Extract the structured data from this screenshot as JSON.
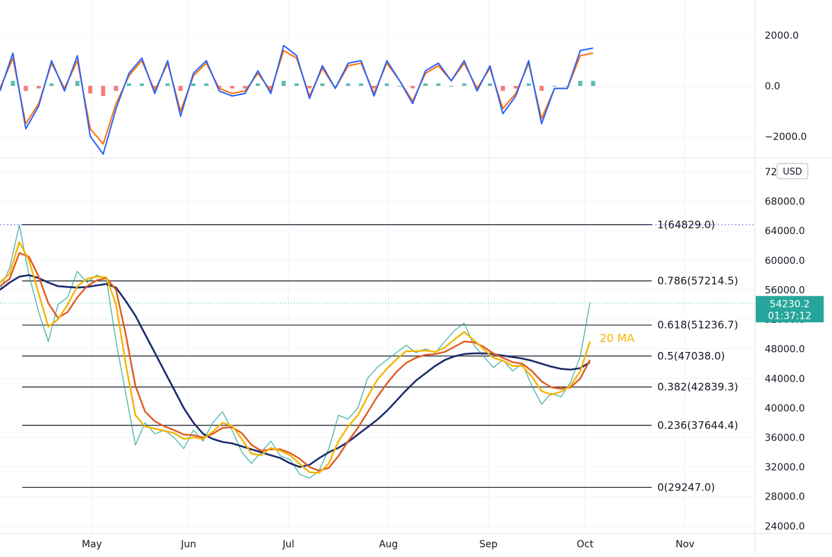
{
  "chart_data": [
    {
      "type": "line",
      "panel": "oscillator",
      "y_ticks": [
        "2000.0",
        "0.0",
        "−2000.0"
      ],
      "y_tick_values": [
        2000,
        0,
        -2000
      ],
      "ylim": [
        -2800,
        2800
      ],
      "grid": true,
      "colors": {
        "fast": "#2962ff",
        "signal": "#ff6d00",
        "hist_up": "#26a69a",
        "hist_down": "#ef5350"
      },
      "x": [
        0,
        4,
        8,
        12,
        16,
        20,
        24,
        28,
        32,
        36,
        40,
        44,
        48,
        52,
        56,
        60,
        64,
        68,
        72,
        76,
        80,
        84,
        88,
        92,
        96,
        100,
        104,
        108,
        112,
        116,
        120,
        124,
        128,
        132,
        136,
        140,
        144,
        148,
        152,
        156,
        160,
        164,
        168,
        172,
        176,
        180,
        184
      ],
      "series": [
        {
          "role": "fast",
          "values": [
            -200,
            1300,
            -1700,
            -800,
            1000,
            -200,
            1200,
            -2000,
            -2700,
            -900,
            500,
            1100,
            -300,
            1000,
            -1200,
            500,
            1000,
            -200,
            -400,
            -300,
            600,
            -300,
            1600,
            1200,
            -500,
            800,
            -100,
            900,
            1000,
            -400,
            1000,
            200,
            -700,
            600,
            900,
            200,
            1000,
            -200,
            800,
            -1100,
            -400,
            1000,
            -1500,
            -100,
            -100,
            1400,
            1500
          ]
        },
        {
          "role": "signal",
          "values": [
            -100,
            1100,
            -1500,
            -700,
            900,
            -100,
            1000,
            -1700,
            -2300,
            -700,
            400,
            1000,
            -200,
            900,
            -1000,
            400,
            900,
            -100,
            -300,
            -200,
            500,
            -200,
            1400,
            1100,
            -400,
            700,
            -100,
            800,
            900,
            -300,
            900,
            200,
            -600,
            500,
            800,
            200,
            900,
            -100,
            700,
            -900,
            -300,
            900,
            -1300,
            -100,
            -100,
            1200,
            1300
          ]
        },
        {
          "role": "histogram",
          "values": [
            -100,
            200,
            -200,
            -100,
            100,
            -100,
            200,
            -300,
            -400,
            -200,
            100,
            100,
            -100,
            100,
            -200,
            100,
            100,
            -100,
            -100,
            -100,
            100,
            -100,
            200,
            100,
            -100,
            100,
            0,
            100,
            100,
            -100,
            100,
            0,
            -100,
            100,
            100,
            0,
            100,
            -100,
            100,
            -200,
            -100,
            100,
            -200,
            0,
            0,
            200,
            200
          ]
        }
      ]
    },
    {
      "type": "line",
      "panel": "price",
      "currency": "USD",
      "y_ticks": [
        "72000.0",
        "68000.0",
        "64000.0",
        "60000.0",
        "56000.0",
        "52000.0",
        "48000.0",
        "44000.0",
        "40000.0",
        "36000.0",
        "32000.0",
        "28000.0",
        "24000.0"
      ],
      "y_tick_values": [
        72000,
        68000,
        64000,
        60000,
        56000,
        52000,
        48000,
        44000,
        40000,
        36000,
        32000,
        28000,
        24000
      ],
      "ylim": [
        23000,
        73500
      ],
      "grid": true,
      "x_ticks": [
        "May",
        "Jun",
        "Jul",
        "Aug",
        "Sep",
        "Oct",
        "Nov"
      ],
      "x_tick_positions": [
        28.5,
        58.5,
        89.5,
        120.5,
        151.5,
        181.5,
        212.5
      ],
      "x_range": [
        0,
        234
      ],
      "last_price": {
        "value": 54230.2,
        "label": "54230.2",
        "countdown": "01:37:12",
        "color": "#26a69a"
      },
      "fib_levels": [
        {
          "ratio": 1,
          "price": 64829.0,
          "label": "1(64829.0)",
          "dashed": true
        },
        {
          "ratio": 0.786,
          "price": 57214.5,
          "label": "0.786(57214.5)",
          "dashed": false
        },
        {
          "ratio": 0.618,
          "price": 51236.7,
          "label": "0.618(51236.7)",
          "dashed": false
        },
        {
          "ratio": 0.5,
          "price": 47038.0,
          "label": "0.5(47038.0)",
          "dashed": false
        },
        {
          "ratio": 0.382,
          "price": 42839.3,
          "label": "0.382(42839.3)",
          "dashed": false
        },
        {
          "ratio": 0.236,
          "price": 37644.4,
          "label": "0.236(37644.4)",
          "dashed": false
        },
        {
          "ratio": 0,
          "price": 29247.0,
          "label": "0(29247.0)",
          "dashed": false
        }
      ],
      "annotation": {
        "text": "20 MA",
        "x": 186,
        "y": 49500,
        "color": "#f5b400"
      },
      "x": [
        0,
        3,
        6,
        9,
        12,
        15,
        18,
        21,
        24,
        27,
        30,
        33,
        36,
        39,
        42,
        45,
        48,
        51,
        54,
        57,
        60,
        63,
        66,
        69,
        72,
        75,
        78,
        81,
        84,
        87,
        90,
        93,
        96,
        99,
        102,
        105,
        108,
        111,
        114,
        117,
        120,
        123,
        126,
        129,
        132,
        135,
        138,
        141,
        144,
        147,
        150,
        153,
        156,
        159,
        162,
        165,
        168,
        171,
        174,
        177,
        180,
        183
      ],
      "series": [
        {
          "role": "price",
          "color": "#26a69a",
          "values": [
            56000,
            59000,
            64800,
            58000,
            53000,
            49000,
            54000,
            55000,
            58500,
            57000,
            58000,
            57500,
            49000,
            42000,
            35000,
            38000,
            36500,
            37000,
            36000,
            34500,
            37000,
            35500,
            38000,
            39500,
            37000,
            34000,
            32500,
            34000,
            35500,
            33500,
            33000,
            31000,
            30500,
            31500,
            34500,
            39000,
            38500,
            40000,
            44000,
            45500,
            46500,
            47500,
            48500,
            47500,
            48000,
            47500,
            49000,
            50500,
            51500,
            48500,
            47000,
            45500,
            46500,
            45000,
            46000,
            43000,
            40500,
            42000,
            41500,
            43500,
            47000,
            54230
          ]
        },
        {
          "role": "ma20",
          "color": "#f5b400",
          "values": [
            57000,
            58200,
            62500,
            60000,
            55500,
            51000,
            52000,
            54000,
            56500,
            57500,
            57800,
            57700,
            54000,
            46000,
            39000,
            37500,
            37200,
            36900,
            36600,
            35800,
            36000,
            35800,
            36800,
            38000,
            37600,
            35800,
            33800,
            33600,
            34600,
            34200,
            33600,
            32400,
            31300,
            31200,
            32500,
            35500,
            37500,
            39000,
            41500,
            43800,
            45300,
            46600,
            47700,
            47700,
            47800,
            47600,
            48200,
            49300,
            50300,
            49200,
            48000,
            46800,
            46400,
            45700,
            45700,
            44200,
            42300,
            41800,
            42200,
            43000,
            45000,
            49000
          ]
        },
        {
          "role": "ma50",
          "color": "#e05a1f",
          "values": [
            56500,
            57500,
            61000,
            60500,
            57800,
            54200,
            52200,
            53000,
            55000,
            56500,
            57300,
            57600,
            56000,
            50000,
            43000,
            39500,
            38200,
            37500,
            37000,
            36400,
            36300,
            36000,
            36500,
            37300,
            37400,
            36600,
            35000,
            34200,
            34400,
            34400,
            33900,
            33100,
            32000,
            31500,
            31900,
            33500,
            35500,
            37300,
            39400,
            41500,
            43300,
            44900,
            46100,
            46800,
            47200,
            47300,
            47600,
            48300,
            49000,
            48900,
            48300,
            47400,
            46800,
            46200,
            46000,
            45000,
            43600,
            42800,
            42600,
            42800,
            44000,
            46500
          ]
        },
        {
          "role": "ma100",
          "color": "#1a2a6c",
          "values": [
            56000,
            57000,
            57800,
            58000,
            57600,
            57000,
            56500,
            56400,
            56300,
            56400,
            56600,
            56800,
            56300,
            54500,
            52500,
            50000,
            47500,
            45000,
            42500,
            40000,
            38000,
            36500,
            35800,
            35400,
            35200,
            34800,
            34400,
            34000,
            33600,
            33200,
            32500,
            32000,
            32300,
            33200,
            34000,
            34600,
            35400,
            36400,
            37400,
            38400,
            39600,
            41000,
            42400,
            43700,
            44700,
            45700,
            46500,
            47000,
            47300,
            47400,
            47400,
            47300,
            47100,
            46900,
            46700,
            46400,
            46000,
            45600,
            45300,
            45200,
            45400,
            46200
          ]
        }
      ]
    }
  ]
}
